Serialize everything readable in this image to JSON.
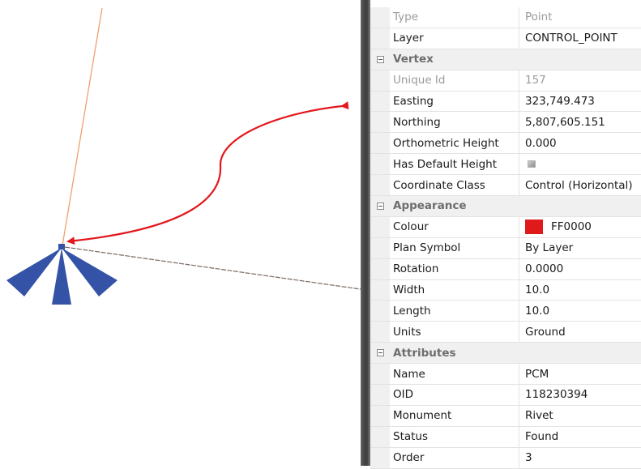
{
  "colors": {
    "symbol": "#3452a6",
    "arrow": "#e3181c",
    "orange_line": "#f0a070",
    "grey_line": "#7a6a60",
    "colour_swatch": "#e0191b"
  },
  "canvas": {
    "symbol_icon": "control-point-symbol"
  },
  "properties": [
    {
      "type": "field",
      "name": "Type",
      "value": "Point",
      "disabled": true
    },
    {
      "type": "field",
      "name": "Layer",
      "value": "CONTROL_POINT"
    },
    {
      "type": "category",
      "name": "Vertex"
    },
    {
      "type": "field",
      "name": "Unique Id",
      "value": "157",
      "disabled": true
    },
    {
      "type": "field",
      "name": "Easting",
      "value": "323,749.473"
    },
    {
      "type": "field",
      "name": "Northing",
      "value": "5,807,605.151"
    },
    {
      "type": "field",
      "name": "Orthometric Height",
      "value": "0.000"
    },
    {
      "type": "field",
      "name": "Has Default Height",
      "value": "",
      "checkbox": true
    },
    {
      "type": "field",
      "name": "Coordinate Class",
      "value": "Control (Horizontal)"
    },
    {
      "type": "category",
      "name": "Appearance"
    },
    {
      "type": "field",
      "name": "Colour",
      "value": "FF0000",
      "swatch": true
    },
    {
      "type": "field",
      "name": "Plan Symbol",
      "value": "By Layer"
    },
    {
      "type": "field",
      "name": "Rotation",
      "value": "0.0000"
    },
    {
      "type": "field",
      "name": "Width",
      "value": "10.0"
    },
    {
      "type": "field",
      "name": "Length",
      "value": "10.0"
    },
    {
      "type": "field",
      "name": "Units",
      "value": "Ground"
    },
    {
      "type": "category",
      "name": "Attributes"
    },
    {
      "type": "field",
      "name": "Name",
      "value": "PCM"
    },
    {
      "type": "field",
      "name": "OID",
      "value": "118230394"
    },
    {
      "type": "field",
      "name": "Monument",
      "value": "Rivet"
    },
    {
      "type": "field",
      "name": "Status",
      "value": "Found"
    },
    {
      "type": "field",
      "name": "Order",
      "value": "3"
    }
  ]
}
